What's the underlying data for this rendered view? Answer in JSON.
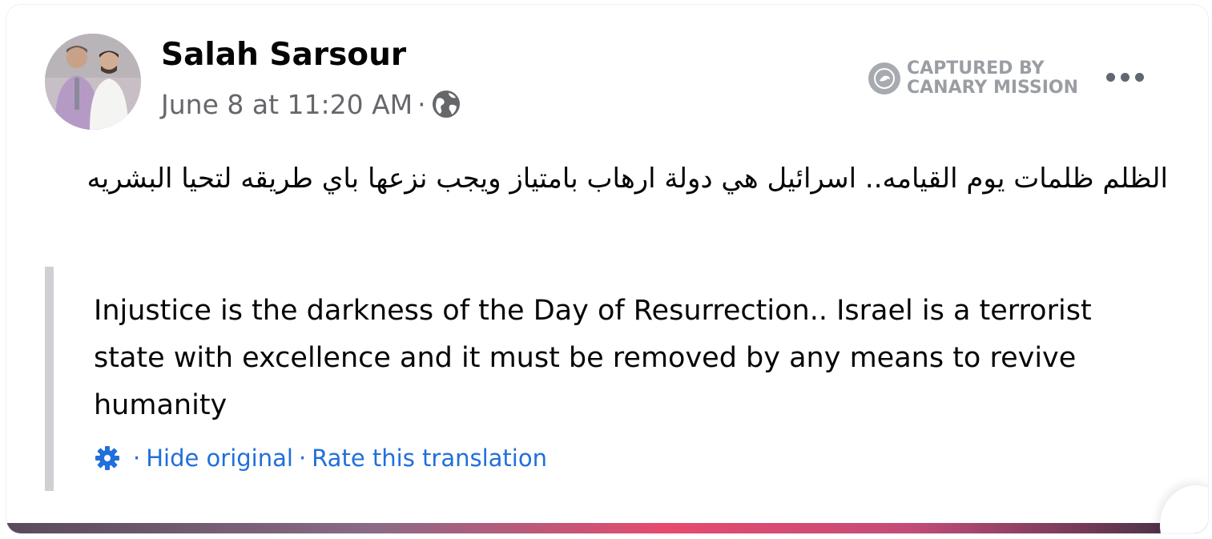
{
  "post": {
    "author": "Salah Sarsour",
    "timestamp": "June 8 at 11:20 AM",
    "separator": "·",
    "privacy_icon": "globe-icon",
    "text_original": "الظلم ظلمات يوم القيامه.. اسرائيل هي دولة ارهاب بامتياز ويجب نزعها باي طريقه لتحيا البشريه",
    "text_translated": "Injustice is the darkness of the Day of Resurrection.. Israel is a terrorist state with excellence and it must be removed by any means to revive humanity"
  },
  "watermark": {
    "line1": "CAPTURED BY",
    "line2": "CANARY MISSION"
  },
  "translation": {
    "settings_icon": "gear-icon",
    "hide_original_label": "Hide original",
    "rate_label": "Rate this translation",
    "separator": "·"
  },
  "colors": {
    "link": "#216fdb",
    "secondary_text": "#65676b",
    "primary_text": "#050505",
    "quote_bar": "#ced0d4"
  }
}
